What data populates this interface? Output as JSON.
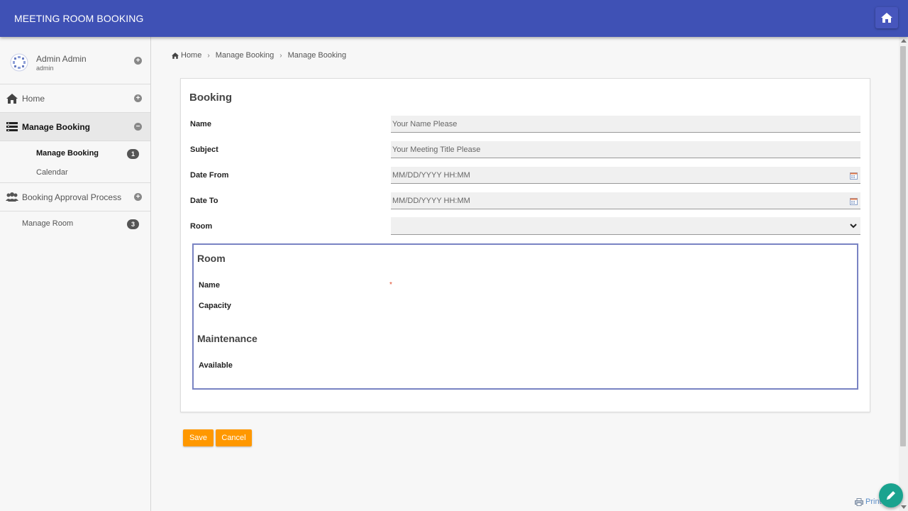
{
  "header": {
    "title": "MEETING ROOM BOOKING",
    "home_icon": "home-icon"
  },
  "user": {
    "name": "Admin Admin",
    "role": "admin"
  },
  "sidebar": {
    "items": [
      {
        "label": "Home",
        "icon": "home-icon"
      },
      {
        "label": "Manage Booking",
        "icon": "list-icon",
        "active": true
      },
      {
        "label": "Booking Approval Process",
        "icon": "users-icon"
      }
    ],
    "sub_items": [
      {
        "label": "Manage Booking",
        "badge": "1",
        "active": true
      },
      {
        "label": "Calendar"
      }
    ],
    "room": {
      "label": "Manage Room",
      "badge": "3"
    }
  },
  "breadcrumb": [
    "Home",
    "Manage Booking",
    "Manage Booking"
  ],
  "form": {
    "title": "Booking",
    "fields": [
      {
        "label": "Name",
        "placeholder": "Your Name Please",
        "value": ""
      },
      {
        "label": "Subject",
        "placeholder": "Your Meeting Title Please",
        "value": ""
      },
      {
        "label": "Date From",
        "placeholder": "MM/DD/YYYY HH:MM",
        "value": ""
      },
      {
        "label": "Date To",
        "placeholder": "MM/DD/YYYY HH:MM",
        "value": ""
      },
      {
        "label": "Room",
        "value": ""
      }
    ]
  },
  "room_box": {
    "title": "Room",
    "name_label": "Name",
    "required_mark": "*",
    "capacity_label": "Capacity",
    "maintenance_title": "Maintenance",
    "available_label": "Available"
  },
  "buttons": {
    "save": "Save",
    "cancel": "Cancel"
  },
  "footer": {
    "print": "Print"
  },
  "colors": {
    "header": "#3f51b5",
    "accent": "#ff9800",
    "fab": "#1aa38f",
    "room_border": "#7983c3"
  }
}
